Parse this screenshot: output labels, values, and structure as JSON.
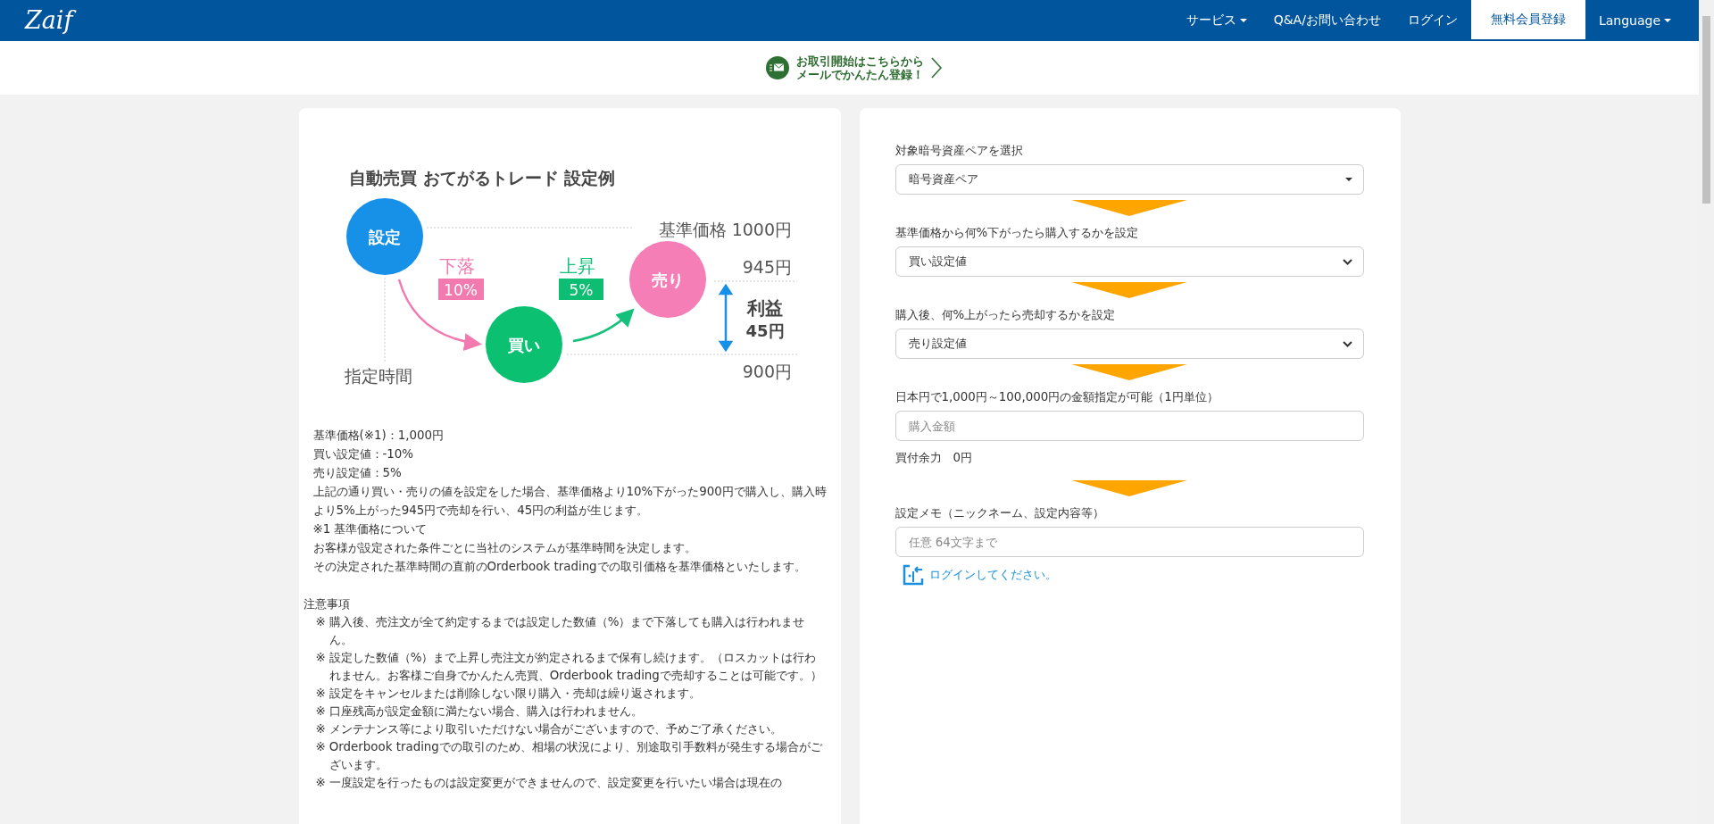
{
  "header": {
    "logo": "Zaif",
    "nav": [
      {
        "label": "サービス",
        "dropdown": true,
        "selected": false
      },
      {
        "label": "Q&A/お問い合わせ",
        "dropdown": false,
        "selected": false
      },
      {
        "label": "ログイン",
        "dropdown": false,
        "selected": false
      },
      {
        "label": "無料会員登録",
        "dropdown": false,
        "selected": true
      },
      {
        "label": "Language",
        "dropdown": true,
        "selected": false
      }
    ]
  },
  "banner": {
    "lines": [
      "お取引開始はこちらから",
      "メールでかんたん登録！"
    ]
  },
  "example": {
    "diagram": {
      "title": "自動売買 おてがるトレード 設定例",
      "setting": "設定",
      "buy": "買い",
      "sell": "売り",
      "drop": "下落",
      "drop_pct": "10%",
      "rise": "上昇",
      "rise_pct": "5%",
      "base_price": "基準価格 1000円",
      "sell_price": "945円",
      "buy_price": "900円",
      "profit_label": "利益",
      "profit": "45円",
      "time": "指定時間"
    },
    "description": [
      "基準価格(※1)：1,000円",
      "買い設定値：-10%",
      "売り設定値：5%",
      "上記の通り買い・売りの値を設定をした場合、基準価格より10%下がった900円で購入し、購入時より5%上がった945円で売却を行い、45円の利益が生じます。",
      "※1 基準価格について",
      "お客様が設定された条件ごとに当社のシステムが基準時間を決定します。",
      "その決定された基準時間の直前のOrderbook tradingでの取引価格を基準価格といたします。"
    ],
    "notes_title": "注意事項",
    "notes": [
      {
        "mark": "※",
        "text": "購入後、売注文が全て約定するまでは設定した数値（%）まで下落しても購入は行われません。"
      },
      {
        "mark": "※",
        "text": "設定した数値（%）まで上昇し売注文が約定されるまで保有し続けます。（ロスカットは行われません。お客様ご自身でかんたん売買、Orderbook tradingで売却することは可能です。）"
      },
      {
        "mark": "※",
        "text": "設定をキャンセルまたは削除しない限り購入・売却は繰り返されます。"
      },
      {
        "mark": "※",
        "text": "口座残高が設定金額に満たない場合、購入は行われません。"
      },
      {
        "mark": "※",
        "text": "メンテナンス等により取引いただけない場合がございますので、予めご了承ください。"
      },
      {
        "mark": "※",
        "text": "Orderbook tradingでの取引のため、相場の状況により、別途取引手数料が発生する場合がございます。"
      },
      {
        "mark": "※",
        "text": "一度設定を行ったものは設定変更ができませんので、設定変更を行いたい場合は現在の"
      }
    ]
  },
  "form": {
    "fields": [
      {
        "kind": "dropdown",
        "label": "対象暗号資産ペアを選択",
        "value": "暗号資産ペア"
      },
      {
        "kind": "select",
        "label": "基準価格から何%下がったら購入するかを設定",
        "value": "買い設定値"
      },
      {
        "kind": "select",
        "label": "購入後、何%上がったら売却するかを設定",
        "value": "売り設定値"
      },
      {
        "kind": "input",
        "label": "日本円で1,000円～100,000円の金額指定が可能（1円単位）",
        "placeholder": "購入金額",
        "note": "買付余力　0円"
      },
      {
        "kind": "input",
        "label": "設定メモ（ニックネーム、設定内容等）",
        "placeholder": "任意 64文字まで"
      }
    ],
    "login_prompt": "ログインしてください。"
  }
}
